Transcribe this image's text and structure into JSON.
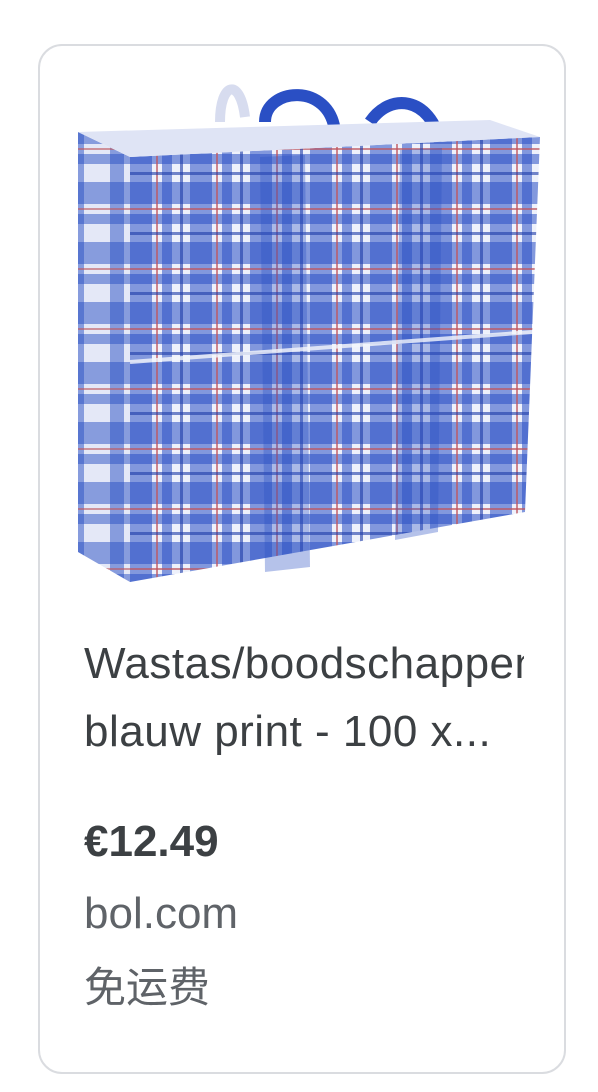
{
  "product": {
    "image_alt": "blue plaid laundry bag",
    "title_line1": "Wastas/boodschappentas",
    "title_line2": "blauw print - 100 x...",
    "price": "€12.49",
    "merchant": "bol.com",
    "shipping": "免运费"
  },
  "colors": {
    "border": "#dadce0",
    "text_primary": "#3c4043",
    "text_secondary": "#5f6368",
    "plaid_blue": "#2a4fc4",
    "plaid_light": "#eef1fb",
    "plaid_red": "#c0565e"
  }
}
